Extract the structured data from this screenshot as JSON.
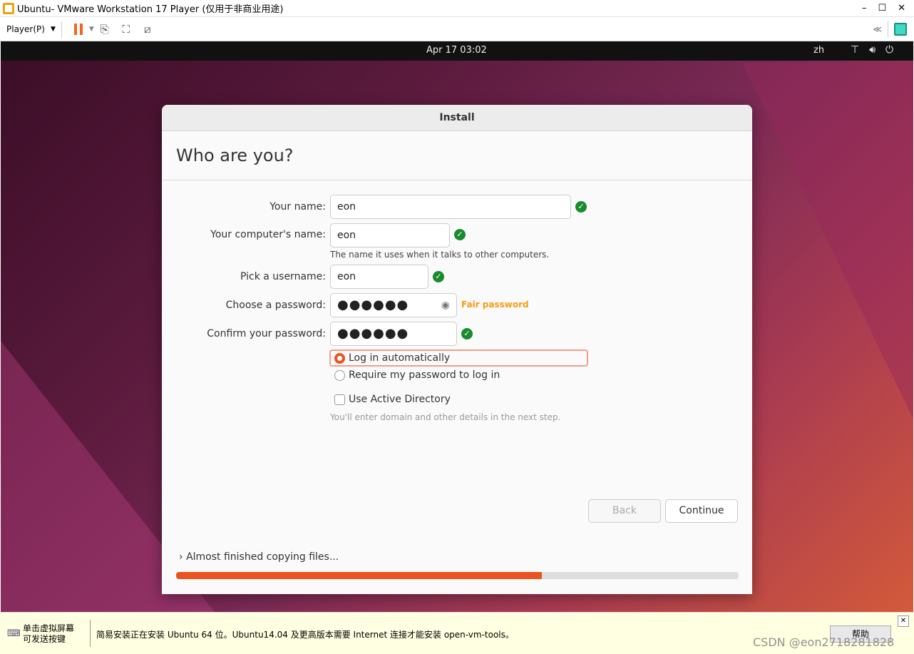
{
  "window": {
    "title": "Ubuntu- VMware Workstation 17 Player (仅用于非商业用途)",
    "minimize": "–",
    "maximize": "☐",
    "close": "✕"
  },
  "toolbar": {
    "player_menu": "Player(P)",
    "collapse": "≪"
  },
  "ubuntu_topbar": {
    "clock": "Apr 17  03:02",
    "lang": "zh"
  },
  "dialog": {
    "title": "Install",
    "heading": "Who are you?",
    "fields": {
      "name_label": "Your name:",
      "name_value": "eon",
      "computer_label": "Your computer's name:",
      "computer_value": "eon",
      "computer_hint": "The name it uses when it talks to other computers.",
      "username_label": "Pick a username:",
      "username_value": "eon",
      "password_label": "Choose a password:",
      "password_value": "●●●●●●",
      "password_strength": "Fair password",
      "confirm_label": "Confirm your password:",
      "confirm_value": "●●●●●●"
    },
    "login_options": {
      "auto": "Log in automatically",
      "require": "Require my password to log in",
      "selected": "auto"
    },
    "active_directory": {
      "label": "Use Active Directory",
      "checked": false,
      "hint": "You'll enter domain and other details in the next step."
    },
    "buttons": {
      "back": "Back",
      "continue": "Continue"
    },
    "status": "Almost finished copying files...",
    "progress_percent": 65,
    "colors": {
      "accent": "#e95420",
      "ok": "#1a8a2e",
      "strength": "#f99b11"
    }
  },
  "infobar": {
    "hint_line1": "单击虚拟屏幕",
    "hint_line2": "可发送按键",
    "message": "简易安装正在安装 Ubuntu 64 位。Ubuntu14.04 及更高版本需要 Internet 连接才能安装 open-vm-tools。",
    "help": "帮助",
    "close": "✕",
    "watermark": "CSDN @eon2718281828"
  }
}
